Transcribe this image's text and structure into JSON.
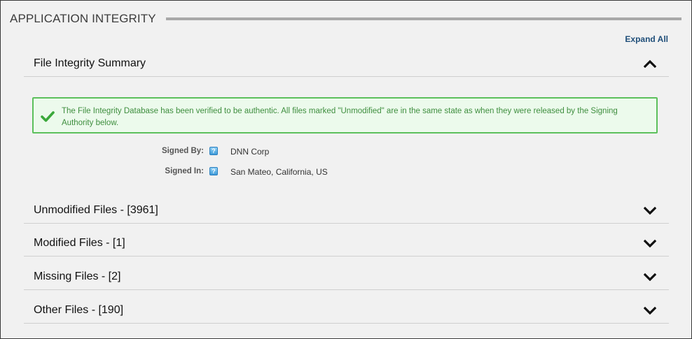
{
  "header": {
    "title": "APPLICATION INTEGRITY"
  },
  "toolbar": {
    "expand_all": "Expand All"
  },
  "summary": {
    "title": "File Integrity Summary",
    "message": "The File Integrity Database has been verified to be authentic. All files marked \"Unmodified\" are in the same state as when they were released by the Signing Authority below.",
    "signed_by_label": "Signed By:",
    "signed_by_value": "DNN Corp",
    "signed_in_label": "Signed In:",
    "signed_in_value": "San Mateo, California, US",
    "help_glyph": "?"
  },
  "sections": [
    {
      "title": "Unmodified Files - [3961]",
      "state": "collapsed"
    },
    {
      "title": "Modified Files - [1]",
      "state": "collapsed"
    },
    {
      "title": "Missing Files - [2]",
      "state": "collapsed"
    },
    {
      "title": "Other Files - [190]",
      "state": "collapsed"
    }
  ],
  "colors": {
    "success_border": "#5cc05c",
    "success_background": "#ecfaec",
    "success_text": "#3e8e3e",
    "link": "#1f4e79"
  },
  "icons": {
    "collapse": "chevron-up-icon",
    "expand": "chevron-down-icon",
    "success": "checkmark-icon",
    "help": "help-icon"
  }
}
